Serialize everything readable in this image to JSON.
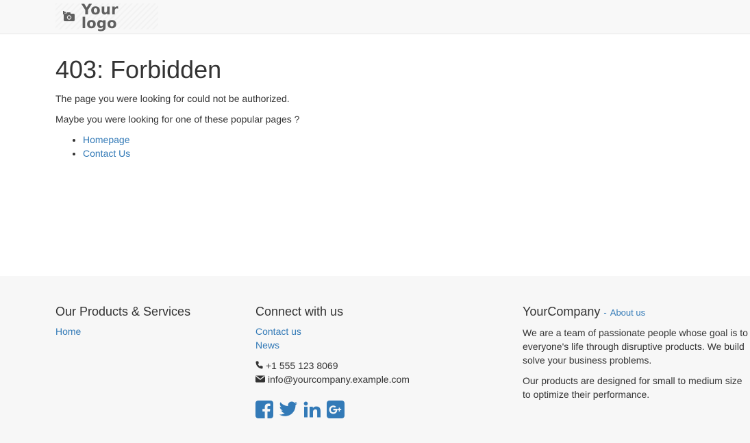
{
  "header": {
    "logo_text": "Your logo",
    "logo_icon": "camera-icon"
  },
  "main": {
    "title": "403: Forbidden",
    "message": "The page you were looking for could not be authorized.",
    "suggestion": "Maybe you were looking for one of these popular pages ?",
    "popular_pages": [
      "Homepage",
      "Contact Us"
    ]
  },
  "footer": {
    "products": {
      "heading": "Our Products & Services",
      "links": [
        "Home"
      ]
    },
    "connect": {
      "heading": "Connect with us",
      "links": [
        "Contact us",
        "News"
      ],
      "phone": "+1 555 123 8069",
      "email": "info@yourcompany.example.com",
      "social_icons": [
        "facebook-icon",
        "twitter-icon",
        "linkedin-icon",
        "google-plus-icon"
      ]
    },
    "company": {
      "name": "YourCompany",
      "separator": "-",
      "about_link": "About us",
      "desc_lines_1": [
        "We are a team of passionate people whose goal is to",
        "everyone's life through disruptive products. We build",
        "solve your business problems."
      ],
      "desc_lines_2": [
        "Our products are designed for small to medium size",
        "to optimize their performance."
      ]
    }
  },
  "colors": {
    "link": "#337ab7",
    "header_bg": "#f8f8f8",
    "footer_bg": "#f7f7f7",
    "text": "#333333"
  }
}
